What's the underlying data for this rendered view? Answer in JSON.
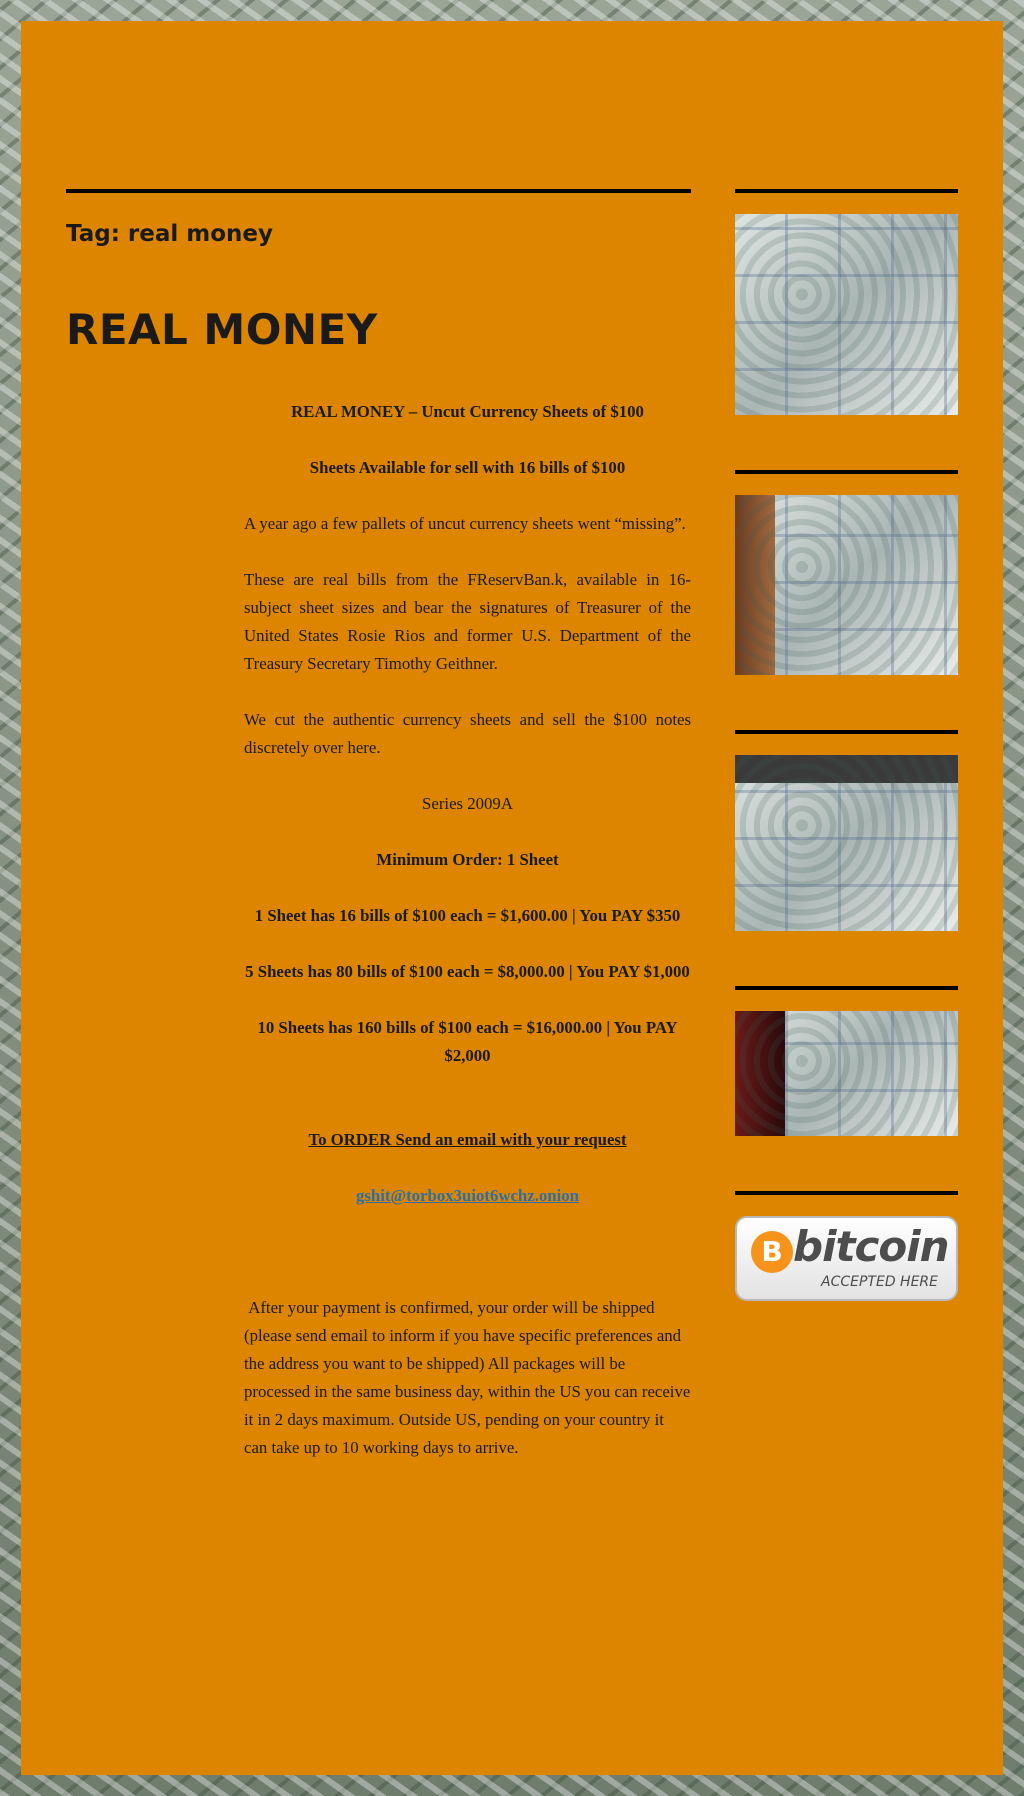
{
  "archive": {
    "title": "Tag: real money"
  },
  "post": {
    "title": "REAL MONEY",
    "headline": "REAL MONEY – Uncut Currency Sheets of $100",
    "availability": "Sheets Available for sell with 16 bills of $100",
    "para1": "A year ago a few pallets of uncut currency sheets went “missing”.",
    "para2": "These are real bills from the FReservBan.k, available in 16-subject sheet sizes and bear the signatures of Treasurer of the United States Rosie Rios and former U.S. Department of the Treasury Secretary Timothy Geithner.",
    "para3": "We cut the authentic currency sheets and sell the $100 notes discretely over here.",
    "series": "Series 2009A",
    "minimum": "Minimum Order: 1 Sheet",
    "price1": "1 Sheet has 16 bills of $100 each = $1,600.00 | You PAY $350",
    "price2": "5 Sheets has 80 bills of $100 each = $8,000.00 | You PAY $1,000",
    "price3": "10 Sheets has 160 bills of $100 each = $16,000.00 | You PAY $2,000",
    "order_cta": "To ORDER Send an email with your request",
    "email": "gshit@torbox3uiot6wchz.onion",
    "shipping": "After your payment is confirmed, your order will be shipped (please send email to inform if you have specific preferences and the address you want to be shipped) All packages will be processed in the same business day, within the US you can receive it in 2 days maximum. Outside US, pending on your country it can take up to 10 working days to arrive."
  },
  "sidebar": {
    "bitcoin_word": "bitcoin",
    "bitcoin_symbol": "B",
    "bitcoin_sub": "ACCEPTED HERE",
    "accent": "#f7931a"
  },
  "colors": {
    "page_bg": "#de8500",
    "link": "#2b6fa8"
  }
}
